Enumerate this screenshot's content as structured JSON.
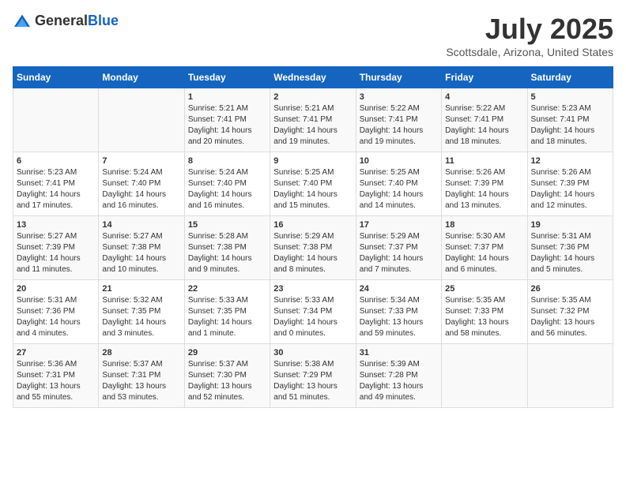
{
  "header": {
    "logo_general": "General",
    "logo_blue": "Blue",
    "month": "July 2025",
    "location": "Scottsdale, Arizona, United States"
  },
  "days_of_week": [
    "Sunday",
    "Monday",
    "Tuesday",
    "Wednesday",
    "Thursday",
    "Friday",
    "Saturday"
  ],
  "weeks": [
    [
      {
        "day": "",
        "content": ""
      },
      {
        "day": "",
        "content": ""
      },
      {
        "day": "1",
        "content": "Sunrise: 5:21 AM\nSunset: 7:41 PM\nDaylight: 14 hours and 20 minutes."
      },
      {
        "day": "2",
        "content": "Sunrise: 5:21 AM\nSunset: 7:41 PM\nDaylight: 14 hours and 19 minutes."
      },
      {
        "day": "3",
        "content": "Sunrise: 5:22 AM\nSunset: 7:41 PM\nDaylight: 14 hours and 19 minutes."
      },
      {
        "day": "4",
        "content": "Sunrise: 5:22 AM\nSunset: 7:41 PM\nDaylight: 14 hours and 18 minutes."
      },
      {
        "day": "5",
        "content": "Sunrise: 5:23 AM\nSunset: 7:41 PM\nDaylight: 14 hours and 18 minutes."
      }
    ],
    [
      {
        "day": "6",
        "content": "Sunrise: 5:23 AM\nSunset: 7:41 PM\nDaylight: 14 hours and 17 minutes."
      },
      {
        "day": "7",
        "content": "Sunrise: 5:24 AM\nSunset: 7:40 PM\nDaylight: 14 hours and 16 minutes."
      },
      {
        "day": "8",
        "content": "Sunrise: 5:24 AM\nSunset: 7:40 PM\nDaylight: 14 hours and 16 minutes."
      },
      {
        "day": "9",
        "content": "Sunrise: 5:25 AM\nSunset: 7:40 PM\nDaylight: 14 hours and 15 minutes."
      },
      {
        "day": "10",
        "content": "Sunrise: 5:25 AM\nSunset: 7:40 PM\nDaylight: 14 hours and 14 minutes."
      },
      {
        "day": "11",
        "content": "Sunrise: 5:26 AM\nSunset: 7:39 PM\nDaylight: 14 hours and 13 minutes."
      },
      {
        "day": "12",
        "content": "Sunrise: 5:26 AM\nSunset: 7:39 PM\nDaylight: 14 hours and 12 minutes."
      }
    ],
    [
      {
        "day": "13",
        "content": "Sunrise: 5:27 AM\nSunset: 7:39 PM\nDaylight: 14 hours and 11 minutes."
      },
      {
        "day": "14",
        "content": "Sunrise: 5:27 AM\nSunset: 7:38 PM\nDaylight: 14 hours and 10 minutes."
      },
      {
        "day": "15",
        "content": "Sunrise: 5:28 AM\nSunset: 7:38 PM\nDaylight: 14 hours and 9 minutes."
      },
      {
        "day": "16",
        "content": "Sunrise: 5:29 AM\nSunset: 7:38 PM\nDaylight: 14 hours and 8 minutes."
      },
      {
        "day": "17",
        "content": "Sunrise: 5:29 AM\nSunset: 7:37 PM\nDaylight: 14 hours and 7 minutes."
      },
      {
        "day": "18",
        "content": "Sunrise: 5:30 AM\nSunset: 7:37 PM\nDaylight: 14 hours and 6 minutes."
      },
      {
        "day": "19",
        "content": "Sunrise: 5:31 AM\nSunset: 7:36 PM\nDaylight: 14 hours and 5 minutes."
      }
    ],
    [
      {
        "day": "20",
        "content": "Sunrise: 5:31 AM\nSunset: 7:36 PM\nDaylight: 14 hours and 4 minutes."
      },
      {
        "day": "21",
        "content": "Sunrise: 5:32 AM\nSunset: 7:35 PM\nDaylight: 14 hours and 3 minutes."
      },
      {
        "day": "22",
        "content": "Sunrise: 5:33 AM\nSunset: 7:35 PM\nDaylight: 14 hours and 1 minute."
      },
      {
        "day": "23",
        "content": "Sunrise: 5:33 AM\nSunset: 7:34 PM\nDaylight: 14 hours and 0 minutes."
      },
      {
        "day": "24",
        "content": "Sunrise: 5:34 AM\nSunset: 7:33 PM\nDaylight: 13 hours and 59 minutes."
      },
      {
        "day": "25",
        "content": "Sunrise: 5:35 AM\nSunset: 7:33 PM\nDaylight: 13 hours and 58 minutes."
      },
      {
        "day": "26",
        "content": "Sunrise: 5:35 AM\nSunset: 7:32 PM\nDaylight: 13 hours and 56 minutes."
      }
    ],
    [
      {
        "day": "27",
        "content": "Sunrise: 5:36 AM\nSunset: 7:31 PM\nDaylight: 13 hours and 55 minutes."
      },
      {
        "day": "28",
        "content": "Sunrise: 5:37 AM\nSunset: 7:31 PM\nDaylight: 13 hours and 53 minutes."
      },
      {
        "day": "29",
        "content": "Sunrise: 5:37 AM\nSunset: 7:30 PM\nDaylight: 13 hours and 52 minutes."
      },
      {
        "day": "30",
        "content": "Sunrise: 5:38 AM\nSunset: 7:29 PM\nDaylight: 13 hours and 51 minutes."
      },
      {
        "day": "31",
        "content": "Sunrise: 5:39 AM\nSunset: 7:28 PM\nDaylight: 13 hours and 49 minutes."
      },
      {
        "day": "",
        "content": ""
      },
      {
        "day": "",
        "content": ""
      }
    ]
  ]
}
